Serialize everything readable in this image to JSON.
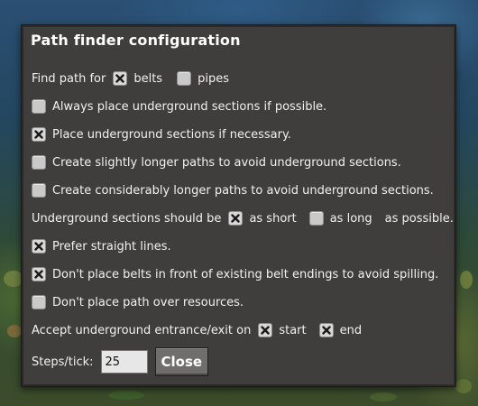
{
  "dialog": {
    "title": "Path finder configuration",
    "find_path": {
      "label": "Find path for",
      "belts": {
        "label": "belts",
        "checked": true
      },
      "pipes": {
        "label": "pipes",
        "checked": false
      }
    },
    "options": [
      {
        "label": "Always place underground sections if possible.",
        "checked": false
      },
      {
        "label": "Place underground sections if necessary.",
        "checked": true
      },
      {
        "label": "Create slightly longer paths to avoid underground sections.",
        "checked": false
      },
      {
        "label": "Create considerably longer paths to avoid underground sections.",
        "checked": false
      }
    ],
    "underground_length": {
      "prefix": "Underground sections should be",
      "short": {
        "label": "as short",
        "checked": true
      },
      "long": {
        "label": "as long",
        "checked": false
      },
      "suffix": "as possible."
    },
    "options2": [
      {
        "label": "Prefer straight lines.",
        "checked": true
      },
      {
        "label": "Don't place belts in front of existing belt endings to avoid spilling.",
        "checked": true
      },
      {
        "label": "Don't place path over resources.",
        "checked": false
      }
    ],
    "entrance_exit": {
      "label": "Accept underground entrance/exit on",
      "start": {
        "label": "start",
        "checked": true
      },
      "end": {
        "label": "end",
        "checked": true
      }
    },
    "steps": {
      "label": "Steps/tick:",
      "value": "25"
    },
    "close_label": "Close"
  },
  "icons": {
    "checked_mark": "x-mark-icon"
  },
  "colors": {
    "dialog_bg": "#3f3e3d",
    "checkbox_off": "#c9c9c9",
    "button_bg": "#6f6e6c"
  }
}
